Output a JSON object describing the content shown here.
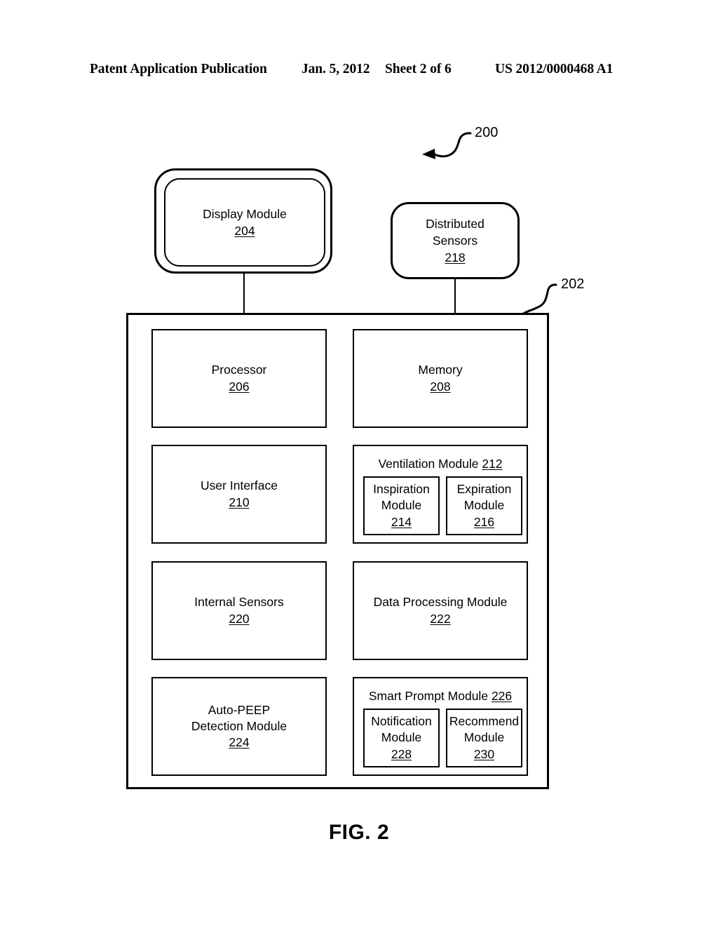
{
  "header": {
    "publication": "Patent Application Publication",
    "date": "Jan. 5, 2012",
    "sheet": "Sheet 2 of 6",
    "number": "US 2012/0000468 A1"
  },
  "figure": {
    "caption": "FIG. 2",
    "system_ref": "200",
    "ventilator_ref": "202"
  },
  "blocks": {
    "display_module": {
      "title": "Display Module",
      "ref": "204"
    },
    "distributed_sensors": {
      "title_line1": "Distributed",
      "title_line2": "Sensors",
      "ref": "218"
    },
    "processor": {
      "title": "Processor",
      "ref": "206"
    },
    "memory": {
      "title": "Memory",
      "ref": "208"
    },
    "user_interface": {
      "title": "User Interface",
      "ref": "210"
    },
    "ventilation_module": {
      "title": "Ventilation Module",
      "ref": "212"
    },
    "inspiration_module": {
      "title_line1": "Inspiration",
      "title_line2": "Module",
      "ref": "214"
    },
    "expiration_module": {
      "title_line1": "Expiration",
      "title_line2": "Module",
      "ref": "216"
    },
    "internal_sensors": {
      "title": "Internal Sensors",
      "ref": "220"
    },
    "data_processing_module": {
      "title": "Data Processing Module",
      "ref": "222"
    },
    "auto_peep_detection_module": {
      "title_line1": "Auto-PEEP",
      "title_line2": "Detection Module",
      "ref": "224"
    },
    "smart_prompt_module": {
      "title": "Smart Prompt Module",
      "ref": "226"
    },
    "notification_module": {
      "title_line1": "Notification",
      "title_line2": "Module",
      "ref": "228"
    },
    "recommend_module": {
      "title_line1": "Recommend",
      "title_line2": "Module",
      "ref": "230"
    }
  },
  "colors": {
    "ink": "#000000",
    "paper": "#ffffff"
  }
}
